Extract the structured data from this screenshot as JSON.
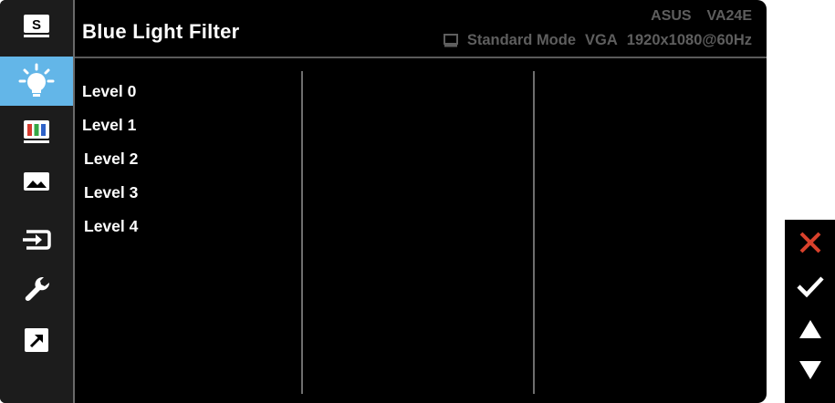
{
  "header": {
    "title": "Blue Light Filter",
    "model": "ASUS  VA24E",
    "status": {
      "mode": "Standard Mode",
      "input": "VGA",
      "resolution": "1920x1080@60Hz"
    }
  },
  "sidebar": {
    "items": [
      {
        "icon": "splendid-icon",
        "glyph": "S"
      },
      {
        "icon": "blue-light-filter-icon",
        "active": true
      },
      {
        "icon": "color-bars-icon"
      },
      {
        "icon": "image-icon"
      },
      {
        "icon": "input-select-icon"
      },
      {
        "icon": "system-setup-icon"
      },
      {
        "icon": "shortcut-icon"
      }
    ]
  },
  "options": [
    "Level 0",
    "Level 1",
    "Level 2",
    "Level 3",
    "Level 4"
  ],
  "keys": [
    {
      "icon": "close-icon",
      "color": "#d9412c"
    },
    {
      "icon": "check-icon",
      "color": "#ffffff"
    },
    {
      "icon": "arrow-up-icon",
      "color": "#ffffff"
    },
    {
      "icon": "arrow-down-icon",
      "color": "#ffffff"
    }
  ],
  "colors": {
    "accent": "#63b6e8",
    "background": "#000000",
    "sidebar": "#1c1c1c",
    "header_text_dim": "#5e5e5e"
  }
}
